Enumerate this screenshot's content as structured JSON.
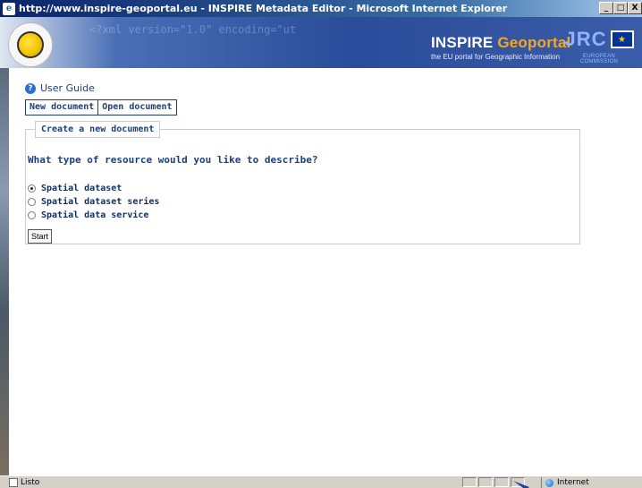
{
  "window": {
    "title": "http://www.inspire-geoportal.eu - INSPIRE Metadata Editor - Microsoft Internet Explorer",
    "controls": [
      "_",
      "□",
      "X"
    ]
  },
  "banner": {
    "xml_decoration": "<?xml version=\"1.0\" encoding=\"ut",
    "brand_main": "INSPIRE",
    "brand_geo": "Geoportal",
    "brand_sub": "the EU portal for Geographic Information",
    "jrc": "JRC",
    "eu_commission": "EUROPEAN COMMISSION"
  },
  "nav": {
    "user_guide": "User Guide",
    "tabs": [
      "New document",
      "Open document"
    ]
  },
  "form": {
    "legend": "Create a new document",
    "question": "What type of resource would you like to describe?",
    "options": [
      {
        "label": "Spatial dataset",
        "checked": true
      },
      {
        "label": "Spatial dataset series",
        "checked": false
      },
      {
        "label": "Spatial data service",
        "checked": false
      }
    ],
    "start_label": "Start"
  },
  "statusbar": {
    "status_text": "Listo",
    "zone_text": "Internet"
  },
  "colors": {
    "accent": "#1c3f7a",
    "titlebar": "#0a246a",
    "banner": "#2a4c9a",
    "brand_geo": "#f5a623"
  }
}
